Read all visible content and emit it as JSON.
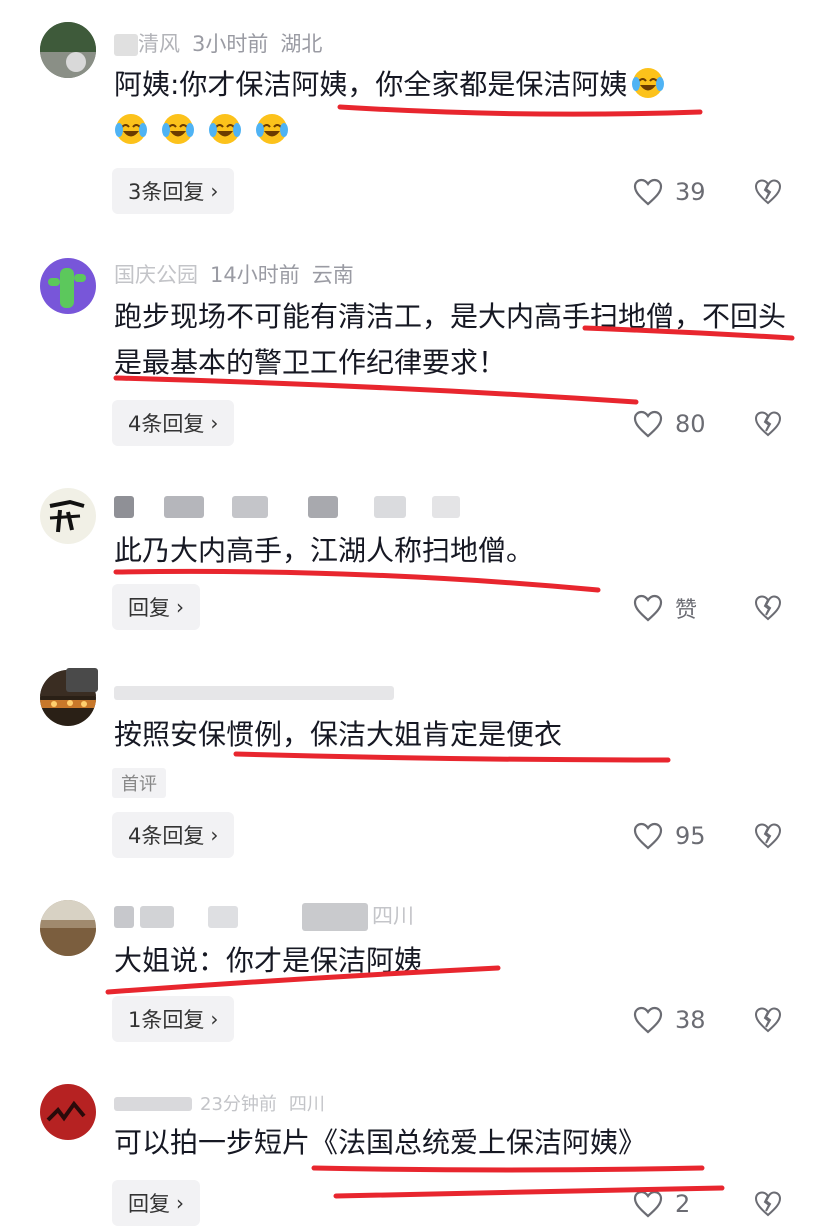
{
  "colors": {
    "underline": "#e8262e",
    "meta": "#9a9ba3",
    "pill": "#f2f2f4"
  },
  "comments": [
    {
      "author": "清风",
      "time": "3小时前",
      "region": "湖北",
      "text": "阿姨:你才保洁阿姨，你全家都是保洁阿姨",
      "emoji_count": 5,
      "reply_label": "3条回复",
      "likes": "39"
    },
    {
      "author": "国庆公园",
      "time": "14小时前",
      "region": "云南",
      "text": "跑步现场不可能有清洁工，是大内高手扫地僧，不回头是最基本的警卫工作纪律要求！",
      "reply_label": "4条回复",
      "likes": "80"
    },
    {
      "author": "",
      "time": "",
      "region": "",
      "text": "此乃大内高手，江湖人称扫地僧。",
      "reply_label": "回复",
      "likes": "赞"
    },
    {
      "author": "",
      "time": "",
      "region": "",
      "text": "按照安保惯例，保洁大姐肯定是便衣",
      "badge": "首评",
      "reply_label": "4条回复",
      "likes": "95"
    },
    {
      "author": "",
      "time": "",
      "region": "四川",
      "text": "大姐说：你才是保洁阿姨",
      "reply_label": "1条回复",
      "likes": "38"
    },
    {
      "author": "",
      "time": "23分钟前",
      "region": "四川",
      "text": "可以拍一步短片《法国总统爱上保洁阿姨》",
      "reply_label": "回复",
      "likes": "2"
    }
  ]
}
